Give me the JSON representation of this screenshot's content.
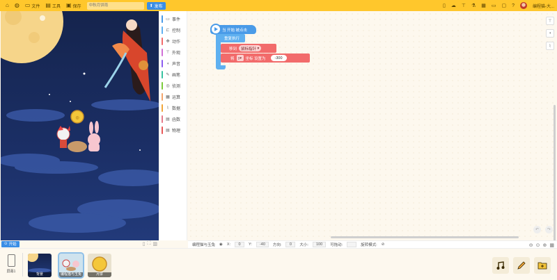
{
  "topbar": {
    "menu_file": "文件",
    "menu_tools": "工具",
    "menu_save": "保存",
    "project_name_placeholder": "中秋月饼雨",
    "publish_label": "发布",
    "user_name": "编程猫-大..."
  },
  "stage": {
    "start_label": "开始"
  },
  "palette": {
    "categories": [
      {
        "label": "事件",
        "color": "#4a9be8",
        "icon": "flag-icon"
      },
      {
        "label": "控制",
        "color": "#5fb0f0",
        "icon": "control-icon"
      },
      {
        "label": "动作",
        "color": "#f26b6b",
        "icon": "motion-icon"
      },
      {
        "label": "外观",
        "color": "#d06fd6",
        "icon": "looks-icon"
      },
      {
        "label": "声音",
        "color": "#8c5cf0",
        "icon": "sound-icon"
      },
      {
        "label": "画笔",
        "color": "#36c2a0",
        "icon": "pen-icon"
      },
      {
        "label": "侦测",
        "color": "#7ccc3c",
        "icon": "sensing-icon"
      },
      {
        "label": "运算",
        "color": "#f4a56c",
        "icon": "operators-icon"
      },
      {
        "label": "数据",
        "color": "#f1a63a",
        "icon": "data-icon"
      },
      {
        "label": "函数",
        "color": "#e67a8a",
        "icon": "function-icon"
      },
      {
        "label": "物理",
        "color": "#e85858",
        "icon": "physics-icon"
      }
    ]
  },
  "blocks": {
    "hat_label": "当 开始 被点击",
    "forever_label": "重复执行",
    "move_label": "移到",
    "move_target": "鼠标指针",
    "set_prefix": "将",
    "set_axis": "y",
    "set_coord_label": "坐标 设置为",
    "set_value": "-300"
  },
  "statusbar": {
    "sprite_name": "编程猫与玉兔",
    "x_label": "X:",
    "x_value": "0",
    "y_label": "Y:",
    "y_value": "-40",
    "dir_label": "方向:",
    "dir_value": "0",
    "size_label": "大小:",
    "size_value": "100",
    "drag_label": "可拖动:",
    "rotate_label": "旋转模式:",
    "rotate_value": "⊘"
  },
  "bottom": {
    "scene_label": "屏幕1",
    "thumbs": [
      {
        "label": "背景"
      },
      {
        "label": "编程猫与玉兔"
      },
      {
        "label": "月饼"
      }
    ]
  }
}
